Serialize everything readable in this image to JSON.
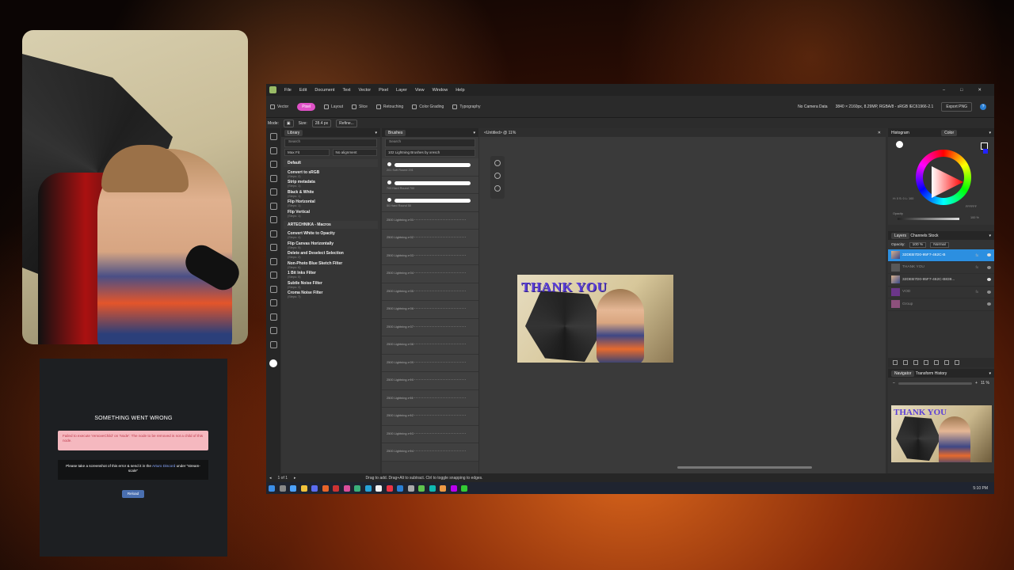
{
  "error_panel": {
    "title": "SOMETHING WENT WRONG",
    "error_text": "Failed to execute 'removeChild' on 'Node': The node to be removed is not a child of this node.",
    "message_prefix": "Please take a screenshot of this error & send it in the",
    "message_link": "Arturo Discord",
    "message_suffix": "under \"stream-scale\"",
    "reload_label": "Reload"
  },
  "menu": [
    "File",
    "Edit",
    "Document",
    "Text",
    "Vector",
    "Pixel",
    "Layer",
    "View",
    "Window",
    "Help"
  ],
  "personas": [
    {
      "label": "Vector"
    },
    {
      "label": "Pixel"
    },
    {
      "label": "Layout"
    },
    {
      "label": "Slice"
    },
    {
      "label": "Retouching"
    },
    {
      "label": "Color Grading"
    },
    {
      "label": "Typography"
    }
  ],
  "toolbar": {
    "camera": "No Camera Data",
    "docinfo": "3840 × 2160px, 8.29MP, RGBA/8 - sRGB IEC61966-2.1",
    "export": "Export PNG"
  },
  "context": {
    "mode": "Mode:",
    "size_label": "Size:",
    "size_value": "28.4 px",
    "refine": "Refine..."
  },
  "library": {
    "tab": "Library",
    "search": "Search",
    "sel1": "Max Fit",
    "sel2": "No alignment",
    "group1": "Default",
    "default_items": [
      {
        "name": "Convert to sRGB",
        "steps": "(Steps: 2)"
      },
      {
        "name": "Strip metadata",
        "steps": "(Steps: 1)"
      },
      {
        "name": "Black & White",
        "steps": "(Steps: 1)"
      },
      {
        "name": "Flip Horizontal",
        "steps": "(Steps: 1)"
      },
      {
        "name": "Flip Vertical",
        "steps": "(Steps: 1)"
      }
    ],
    "group2": "ARTECHNIKA - Macros",
    "macro_items": [
      {
        "name": "Convert White to Opacity",
        "steps": "(Steps: 4)"
      },
      {
        "name": "Flip Canvas Horizontally",
        "steps": "(Steps: 5)"
      },
      {
        "name": "Delete and Deselect Selection",
        "steps": "(Steps: 2)"
      },
      {
        "name": "Non-Photo Blue Sketch Filter",
        "steps": "(Steps: 6)"
      },
      {
        "name": "1 Bit Inks Filter",
        "steps": "(Steps: 5)"
      },
      {
        "name": "Subtle Noise Filter",
        "steps": "(Steps: 3)"
      },
      {
        "name": "Croma Noise Filter",
        "steps": "(Steps: 7)"
      }
    ]
  },
  "brushes": {
    "tab": "Brushes",
    "search": "Search",
    "category": "102 Lightning Brushes by xresch",
    "round": [
      {
        "size": "201",
        "name": "Soft Round 201"
      },
      {
        "size": "700",
        "name": "Hard Round 700"
      },
      {
        "size": "50",
        "name": "Hard Round 50"
      }
    ],
    "lightning": [
      {
        "size": "2500",
        "name": "Lightning x 01"
      },
      {
        "size": "2500",
        "name": "Lightning x 02"
      },
      {
        "size": "2500",
        "name": "Lightning x 03"
      },
      {
        "size": "2500",
        "name": "Lightning x 04"
      },
      {
        "size": "2500",
        "name": "Lightning x 05"
      },
      {
        "size": "2500",
        "name": "Lightning x 06"
      },
      {
        "size": "2500",
        "name": "Lightning x 07"
      },
      {
        "size": "2500",
        "name": "Lightning x 08"
      },
      {
        "size": "2500",
        "name": "Lightning x 09"
      },
      {
        "size": "2500",
        "name": "Lightning x 10"
      },
      {
        "size": "2500",
        "name": "Lightning x 11"
      },
      {
        "size": "2500",
        "name": "Lightning x 12"
      },
      {
        "size": "2500",
        "name": "Lightning x 13"
      },
      {
        "size": "2500",
        "name": "Lightning x 14"
      }
    ]
  },
  "document": {
    "tab": "<Untitled> @ 11%",
    "thumb_text": "THANK YOU"
  },
  "color": {
    "tab1": "Histogram",
    "tab2": "Color",
    "hex": "FFFFFF",
    "opacity_label": "Opacity",
    "opacity": "100 %",
    "hsl": "H: 0 S: 0 L: 100"
  },
  "layers": {
    "tabs": [
      "Layers",
      "Channels",
      "Stock"
    ],
    "opacity_label": "Opacity:",
    "opacity": "100 %",
    "blend": "Normal",
    "rows": [
      {
        "name": "32DEB7D0-95F7-462C-B"
      },
      {
        "name": "THANK YOU"
      },
      {
        "name": "32DEB7D0-95F7-462C-B838..."
      },
      {
        "name": "VOD"
      },
      {
        "name": "Group"
      }
    ]
  },
  "navigator": {
    "tabs": [
      "Navigator",
      "Transform",
      "History"
    ],
    "zoom": "11 %"
  },
  "status": {
    "page": "1 of 1",
    "hint": "Drag to add. Drag+Alt to subtract. Ctrl to toggle snapping to edges."
  },
  "clock": "5:10 PM",
  "colors": {
    "accent": "#2c8fe0",
    "pixel_persona": "#e052c7",
    "error_bg": "#f5b8bf",
    "error_text": "#c0394b"
  }
}
